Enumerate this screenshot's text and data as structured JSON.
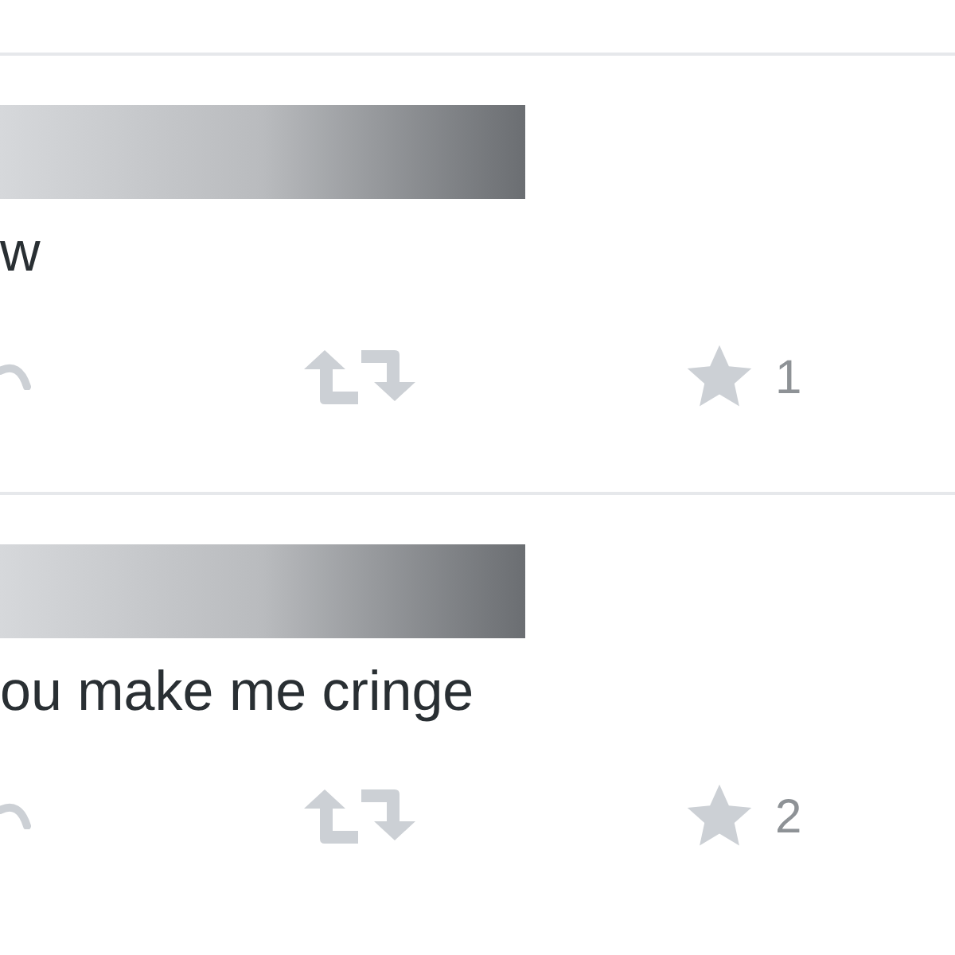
{
  "tweets": [
    {
      "text": "w",
      "favorites": "1"
    },
    {
      "text": "ou make me cringe",
      "favorites": "2"
    }
  ]
}
